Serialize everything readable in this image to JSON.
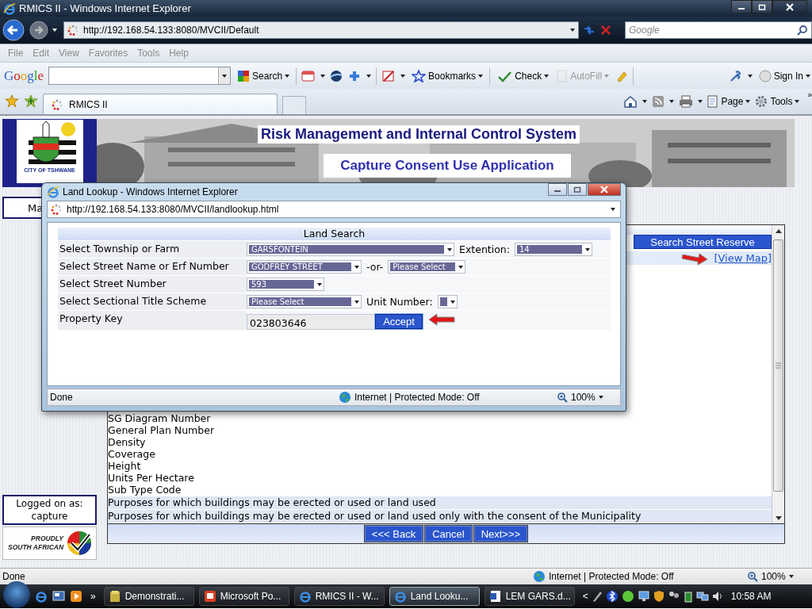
{
  "browser": {
    "title": "RMICS II - Windows Internet Explorer",
    "address": "http://192.168.54.133:8080/MVCII/Default",
    "search_placeholder": "Google",
    "menu": [
      "File",
      "Edit",
      "View",
      "Favorites",
      "Tools",
      "Help"
    ],
    "google_toolbar": {
      "logo": "Google",
      "buttons": [
        {
          "label": "Search",
          "disabled": false
        },
        {
          "label": "Bookmarks",
          "disabled": false
        },
        {
          "label": "Check",
          "disabled": false
        },
        {
          "label": "AutoFill",
          "disabled": true
        },
        {
          "label": "Sign In",
          "disabled": false
        }
      ]
    },
    "tabs": [
      {
        "label": "RMICS II",
        "selected": true
      }
    ],
    "command_bar": {
      "page": "Page",
      "tools": "Tools",
      "more": "»"
    }
  },
  "header": {
    "logo_caption": "CITY OF TSHWANE",
    "title": "Risk Management and Internal Control System",
    "subtitle": "Capture Consent Use Application"
  },
  "sidebar": {
    "menu_button": "Ma",
    "logged_on_label": "Logged on as:",
    "user": "capture",
    "badge_top": "PROUDLY",
    "badge_bottom": "SOUTH AFRICAN"
  },
  "content": {
    "search_button": "Search Street Reserve",
    "view_map_link": "[View Map]",
    "rows": [
      {
        "label": "SG Diagram Number",
        "shaded": false
      },
      {
        "label": "General Plan Number",
        "shaded": false
      },
      {
        "label": "Density",
        "shaded": false
      },
      {
        "label": "Coverage",
        "shaded": false
      },
      {
        "label": "Height",
        "shaded": false
      },
      {
        "label": "Units Per Hectare",
        "shaded": false
      },
      {
        "label": "Sub Type Code",
        "shaded": false
      },
      {
        "label": "Purposes for which buildings may be erected or used or land used",
        "shaded": true
      },
      {
        "label": "Purposes for which buildings may be erected or used or land used only with the consent of the Municipality",
        "shaded": true
      }
    ],
    "buttons": [
      "<<< Back",
      "Cancel",
      "Next>>>"
    ]
  },
  "status_bar": {
    "text": "Done",
    "zone": "Internet | Protected Mode: Off",
    "zoom": "100%"
  },
  "dialog": {
    "title": "Land Lookup - Windows Internet Explorer",
    "address": "http://192.168.54.133:8080/MVCII/landlookup.html",
    "heading": "Land Search",
    "rows": [
      {
        "label": "Select Township or Farm",
        "fields": [
          {
            "kind": "select",
            "value": "GARSFONTEIN"
          },
          {
            "kind": "label",
            "text": "Extention:"
          },
          {
            "kind": "select",
            "value": "14"
          }
        ]
      },
      {
        "label": "Select Street Name or Erf Number",
        "fields": [
          {
            "kind": "select",
            "value": "GODFREY STREET"
          },
          {
            "kind": "label",
            "text": "-or-"
          },
          {
            "kind": "select",
            "value": "Please Select"
          }
        ]
      },
      {
        "label": "Select Street Number",
        "fields": [
          {
            "kind": "select",
            "value": "593"
          }
        ]
      },
      {
        "label": "Select Sectional Title Scheme",
        "fields": [
          {
            "kind": "select",
            "value": "Please Select"
          },
          {
            "kind": "label",
            "text": "Unit Number:"
          },
          {
            "kind": "select"
          }
        ]
      },
      {
        "label": "Property Key",
        "fields": [
          {
            "kind": "input",
            "value": "023803646"
          },
          {
            "kind": "button",
            "text": "Accept"
          }
        ]
      }
    ],
    "status": {
      "text": "Done",
      "zone": "Internet | Protected Mode: Off",
      "zoom": "100%"
    }
  },
  "taskbar": {
    "more": "»",
    "items": [
      {
        "label": "Demonstrati...",
        "selected": false
      },
      {
        "label": "Microsoft Po...",
        "selected": false
      },
      {
        "label": "RMICS II - W...",
        "selected": false
      },
      {
        "label": "Land Looku...",
        "selected": true
      },
      {
        "label": "LEM GARS.d...",
        "selected": false
      }
    ],
    "tray_toggle": "<",
    "clock": "10:58 AM"
  }
}
